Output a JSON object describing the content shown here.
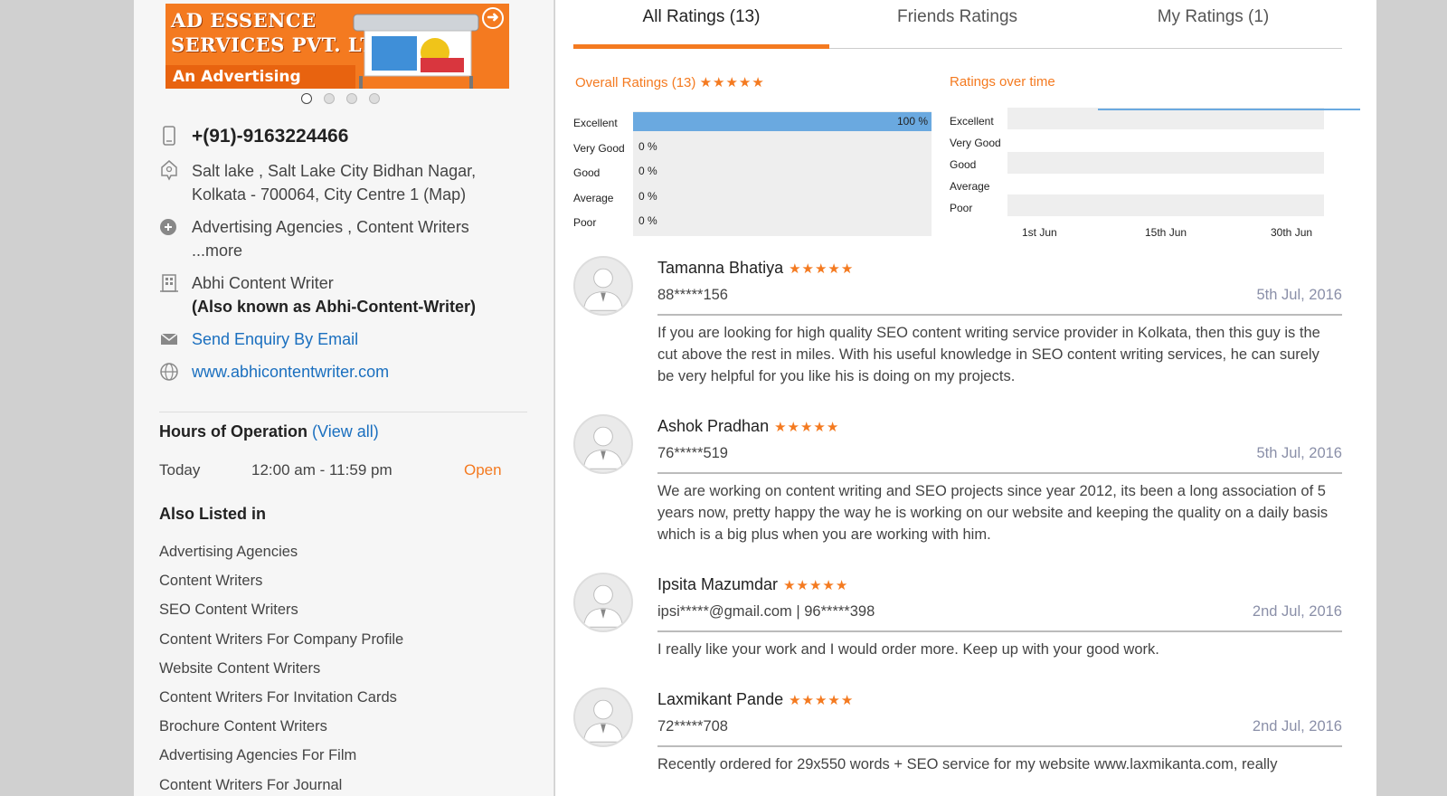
{
  "banner": {
    "line1": "AD ESSENCE",
    "line2": "SERVICES PVT. LTD.",
    "line3": "An Advertising Agency",
    "next_glyph": "➜"
  },
  "contact": {
    "phone": "+(91)-9163224466",
    "address_line1": "Salt lake , Salt Lake City Bidhan Nagar,",
    "address_line2": "Kolkata - 700064, City Centre 1 (Map)",
    "categories_line1": "Advertising Agencies , Content Writers",
    "categories_more": "...more",
    "name": "Abhi Content Writer",
    "aka": "(Also known as Abhi-Content-Writer)",
    "enquiry": "Send Enquiry By Email",
    "website": "www.abhicontentwriter.com"
  },
  "hours": {
    "title": "Hours of Operation",
    "view_all": "(View all)",
    "day": "Today",
    "time": "12:00 am - 11:59 pm",
    "status": "Open"
  },
  "also_listed": {
    "title": "Also Listed in",
    "items": [
      "Advertising Agencies",
      "Content Writers",
      "SEO Content Writers",
      "Content Writers For Company Profile",
      "Website Content Writers",
      "Content Writers For Invitation Cards",
      "Brochure Content Writers",
      "Advertising Agencies For Film",
      "Content Writers For Journal"
    ]
  },
  "tabs": [
    {
      "label": "All Ratings (13)",
      "active": true
    },
    {
      "label": "Friends Ratings",
      "active": false
    },
    {
      "label": "My Ratings (1)",
      "active": false
    }
  ],
  "overall": {
    "title": "Overall Ratings (13)",
    "stars": "★★★★★"
  },
  "overtime": {
    "title": "Ratings over time"
  },
  "chart_data": [
    {
      "type": "bar",
      "categories": [
        "Excellent",
        "Very Good",
        "Good",
        "Average",
        "Poor"
      ],
      "values": [
        100,
        0,
        0,
        0,
        0
      ],
      "labels": [
        "100 %",
        "0 %",
        "0 %",
        "0 %",
        "0 %"
      ],
      "title": "Overall Ratings (13)",
      "xlim": [
        0,
        100
      ]
    },
    {
      "type": "line",
      "categories": [
        "Excellent",
        "Very Good",
        "Good",
        "Average",
        "Poor"
      ],
      "x_ticks": [
        "1st Jun",
        "15th Jun",
        "30th Jun"
      ],
      "title": "Ratings over time"
    }
  ],
  "reviews": [
    {
      "name": "Tamanna Bhatiya",
      "stars": "★★★★★",
      "contact": "88*****156",
      "date": "5th Jul, 2016",
      "text": "If you are looking for high quality SEO content writing service provider in Kolkata, then this guy is the cut above the rest in miles. With his useful knowledge in SEO content writing services, he can surely be very helpful for you like his is doing on my projects."
    },
    {
      "name": "Ashok Pradhan",
      "stars": "★★★★★",
      "contact": "76*****519",
      "date": "5th Jul, 2016",
      "text": "We are working on content writing and SEO projects since year 2012, its been a long association of 5 years now, pretty happy the way he is working on our website and keeping the quality on a daily basis which is a big plus when you are working with him."
    },
    {
      "name": "Ipsita Mazumdar",
      "stars": "★★★★★",
      "contact": "ipsi*****@gmail.com | 96*****398",
      "date": "2nd Jul, 2016",
      "text": "I really like your work and I would order more. Keep up with your good work."
    },
    {
      "name": "Laxmikant Pande",
      "stars": "★★★★★",
      "contact": "72*****708",
      "date": "2nd Jul, 2016",
      "text": "Recently ordered for 29x550 words + SEO service for my website www.laxmikanta.com, really"
    }
  ]
}
